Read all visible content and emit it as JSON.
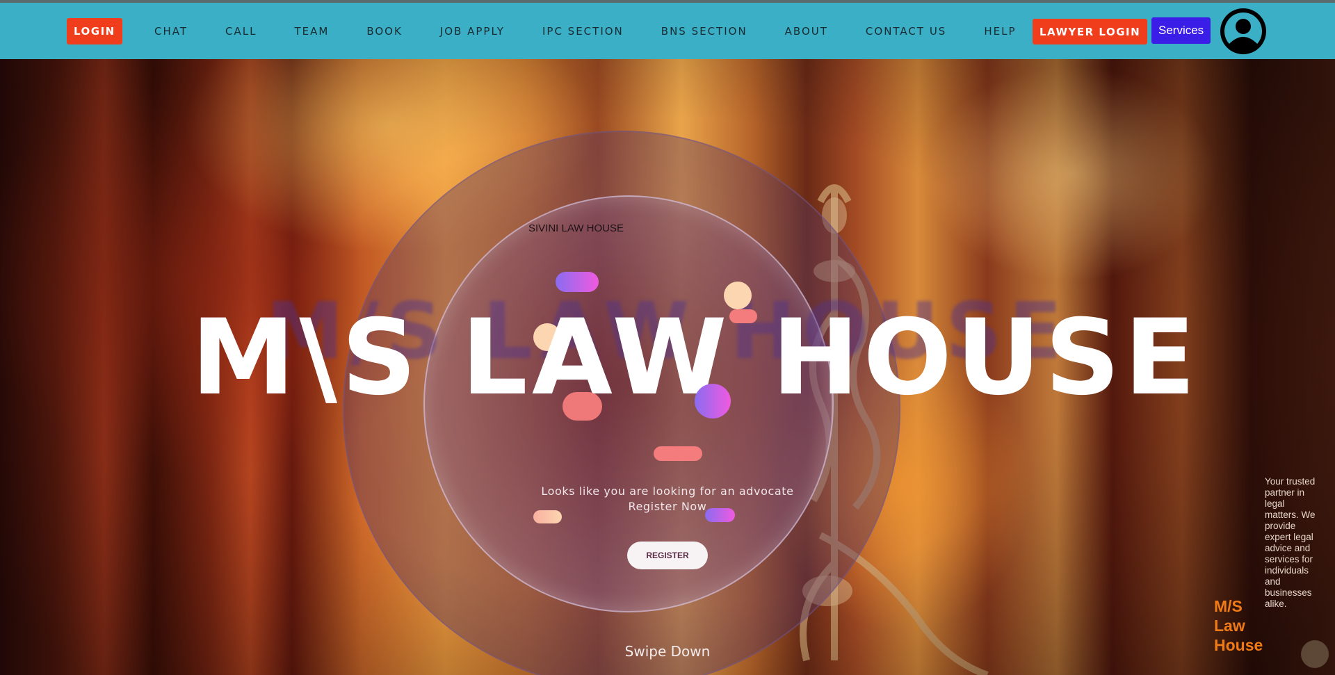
{
  "nav": {
    "login_label": "LOGIN",
    "links": [
      {
        "label": "CHAT"
      },
      {
        "label": "CALL"
      },
      {
        "label": "TEAM"
      },
      {
        "label": "BOOK"
      },
      {
        "label": "JOB APPLY"
      },
      {
        "label": "IPC SECTION"
      },
      {
        "label": "BNS SECTION"
      },
      {
        "label": "ABOUT"
      },
      {
        "label": "CONTACT US"
      },
      {
        "label": "HELP"
      }
    ],
    "lawyer_login_label": "LAWYER LOGIN",
    "services_label": "Services",
    "avatar_icon": "user-avatar-icon"
  },
  "hero": {
    "brand_small": "SIVINI LAW HOUSE",
    "title": "M\\S LAW HOUSE",
    "title_shadow": "M/S LAW HOUSE",
    "tagline_line1": "Looks like you are looking for an advocate",
    "tagline_line2": "Register Now",
    "register_label": "REGISTER",
    "swipe_label": "Swipe Down"
  },
  "widget": {
    "brand": "M/S Law House",
    "description": "Your trusted partner in legal matters. We provide expert legal advice and services for individuals and businesses alike."
  },
  "colors": {
    "navbar": "#3aafc6",
    "login_button": "#f03d1c",
    "services_button": "#3a1ee8",
    "brand_orange": "#f07b16"
  }
}
